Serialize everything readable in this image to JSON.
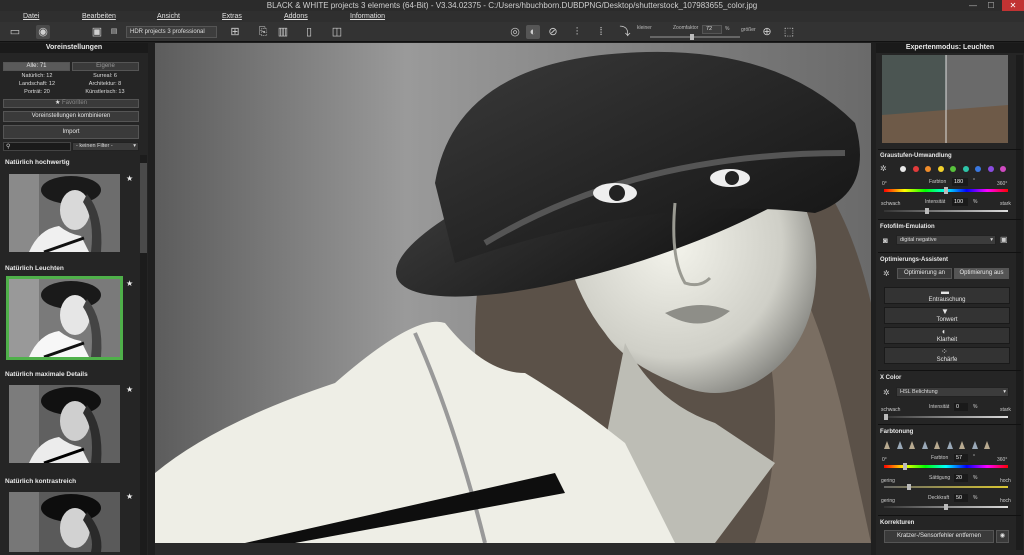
{
  "window": {
    "title": "BLACK & WHITE projects 3 elements (64-Bit) - V3.34.02375 - C:/Users/hbuchborn.DUBDPNG/Desktop/shutterstock_107983655_color.jpg",
    "minimize": "—",
    "maximize": "☐",
    "close": "✕"
  },
  "menu": [
    "Datei",
    "Bearbeiten",
    "Ansicht",
    "Extras",
    "Addons",
    "Information"
  ],
  "toolbar": {
    "send_to_label": "HDR projects 3 professional",
    "zoom_label": "Zoomfaktor",
    "zoom_value": "72",
    "zoom_unit": "%",
    "smaller": "kleiner",
    "larger": "größer"
  },
  "left": {
    "header": "Voreinstellungen",
    "tab_all": "Alle: 71",
    "tab_own": "Eigene",
    "filters": [
      [
        "Natürlich: 12",
        "Surreal: 6"
      ],
      [
        "Landschaft: 12",
        "Architektur: 8"
      ],
      [
        "Porträt: 20",
        "Künstlerisch: 13"
      ]
    ],
    "favorites": "Favoriten",
    "combine": "Voreinstellungen kombinieren",
    "import": "Import",
    "filter_dropdown": "- keinen Filter -",
    "presets": [
      {
        "name": "Natürlich hochwertig"
      },
      {
        "name": "Natürlich Leuchten"
      },
      {
        "name": "Natürlich maximale Details"
      },
      {
        "name": "Natürlich kontrastreich"
      }
    ]
  },
  "right": {
    "header": "Expertenmodus: Leuchten",
    "gray": {
      "title": "Graustufen-Umwandlung",
      "deg0": "0°",
      "deg360": "360°",
      "farbton_label": "Farbton",
      "farbton_value": "180",
      "farbton_unit": "°",
      "weak": "schwach",
      "strong": "stark",
      "intensity_label": "Intensität",
      "intensity_value": "100",
      "intensity_unit": "%",
      "dot_colors": [
        "#e8e8e8",
        "#e23b3b",
        "#f08c2a",
        "#f2d12b",
        "#58c23c",
        "#2ec4a8",
        "#3a78e0",
        "#8a4ce0",
        "#d04ac0"
      ]
    },
    "film": {
      "title": "Fotofilm-Emulation",
      "value": "digital negative"
    },
    "opt": {
      "title": "Optimierungs-Assistent",
      "on": "Optimierung an",
      "off": "Optimierung aus",
      "buttons": [
        "Entrauschung",
        "Tonwert",
        "Klarheit",
        "Schärfe"
      ]
    },
    "xcolor": {
      "title": "X Color",
      "value": "HSL Belichtung",
      "weak": "schwach",
      "strong": "stark",
      "intensity_label": "Intensität",
      "intensity_value": "0",
      "intensity_unit": "%"
    },
    "tone": {
      "title": "Farbtonung",
      "deg0": "0°",
      "deg360": "360°",
      "farbton_label": "Farbton",
      "farbton_value": "57",
      "farbton_unit": "°",
      "low": "gering",
      "high": "hoch",
      "sat_label": "Sättigung",
      "sat_value": "20",
      "sat_unit": "%",
      "low2": "gering",
      "high2": "hoch",
      "opacity_label": "Deckkraft",
      "opacity_value": "50",
      "opacity_unit": "%"
    },
    "corr": {
      "title": "Korrekturen",
      "button": "Kratzer-/Sensorfehler entfernen"
    }
  }
}
